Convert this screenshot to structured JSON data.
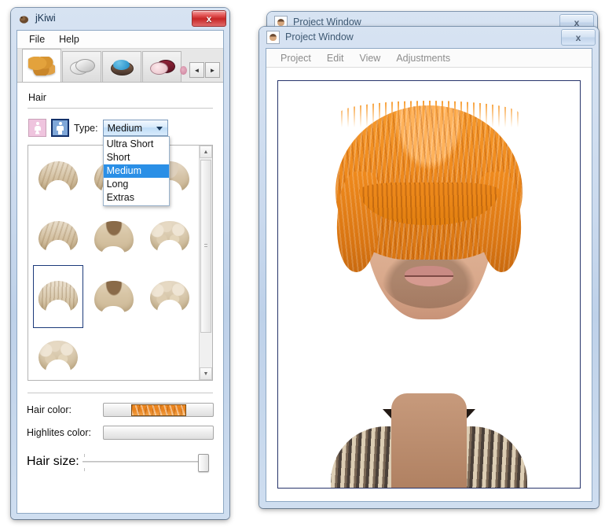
{
  "app": {
    "title": "jKiwi",
    "icon": "kiwi-icon",
    "close_label": "x"
  },
  "menu": {
    "items": [
      {
        "label": "File"
      },
      {
        "label": "Help"
      }
    ]
  },
  "tabs": [
    {
      "name": "hair",
      "icon": "wig-icon",
      "active": true
    },
    {
      "name": "skin",
      "icon": "cream-jar-icon",
      "active": false
    },
    {
      "name": "eyes",
      "icon": "eyeshadow-icon",
      "active": false
    },
    {
      "name": "lips",
      "icon": "blush-icon",
      "active": false
    }
  ],
  "tab_nav": {
    "prev_label": "◄",
    "next_label": "►"
  },
  "panel": {
    "section_title": "Hair",
    "gender": {
      "female_label": "female",
      "male_label": "male",
      "selected": "male"
    },
    "type": {
      "label": "Type:",
      "value": "Medium",
      "expanded": true,
      "options": [
        "Ultra Short",
        "Short",
        "Medium",
        "Long",
        "Extras"
      ],
      "selected_option": "Medium"
    },
    "gallery": {
      "selected_index": 6,
      "items": [
        {
          "style": "wavy"
        },
        {
          "style": "wavy"
        },
        {
          "style": "plain"
        },
        {
          "style": "wavy"
        },
        {
          "style": "bowl"
        },
        {
          "style": "curly"
        },
        {
          "style": "spiky"
        },
        {
          "style": "bowl"
        },
        {
          "style": "curly"
        },
        {
          "style": "curly"
        }
      ]
    },
    "scrollbar": {
      "up_label": "▲",
      "down_label": "▼"
    },
    "hair_color": {
      "label": "Hair color:",
      "swatch_color": "#ef8a1c"
    },
    "highlites_color": {
      "label": "Highlites color:",
      "swatch_color": "#e2e2e2"
    },
    "hair_size": {
      "label": "Hair size:",
      "value": 90
    }
  },
  "project_window_back": {
    "title": "Project Window",
    "icon": "portrait-icon",
    "close_label": "x"
  },
  "project_window_front": {
    "title": "Project Window",
    "icon": "portrait-icon",
    "close_label": "x",
    "menu": [
      {
        "label": "Project"
      },
      {
        "label": "Edit"
      },
      {
        "label": "View"
      },
      {
        "label": "Adjustments"
      }
    ]
  },
  "colors": {
    "accent_blue": "#2a8fe6",
    "title_bar": "#cbdaee",
    "close_red": "#c72626",
    "selection_border": "#1c3a7a",
    "hair_orange": "#ef8a1d"
  }
}
